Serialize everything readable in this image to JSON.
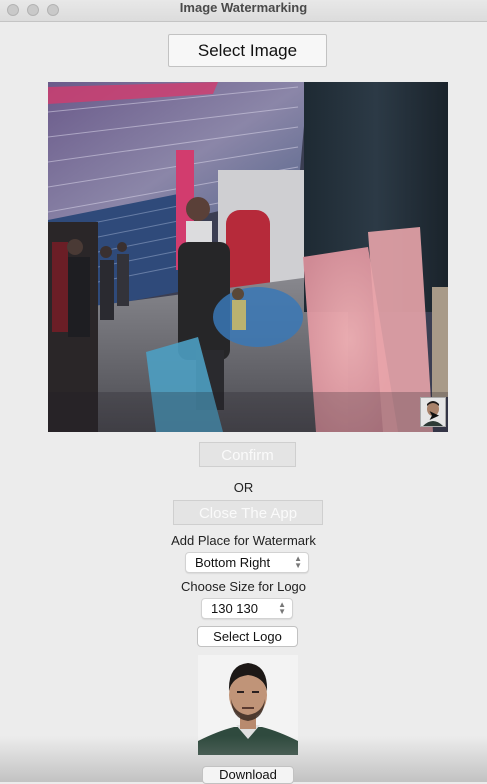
{
  "window": {
    "title": "Image Watermarking",
    "controls": [
      "close",
      "minimize",
      "zoom"
    ]
  },
  "select_image_button": "Select Image",
  "preview": {
    "description_icon": "image-preview",
    "watermark_icon": "portrait-thumbnail-icon"
  },
  "confirm_button": "Confirm",
  "or_label": "OR",
  "close_button": "Close The App",
  "place_label": "Add Place for Watermark",
  "place_select": {
    "value": "Bottom Right"
  },
  "size_label": "Choose Size for Logo",
  "size_select": {
    "value": "130 130"
  },
  "select_logo_button": "Select Logo",
  "download_button": "Download",
  "colors": {
    "window_bg": "#ececec",
    "disabled_text": "#fafafa",
    "traffic_light": "#c9c9c9"
  }
}
